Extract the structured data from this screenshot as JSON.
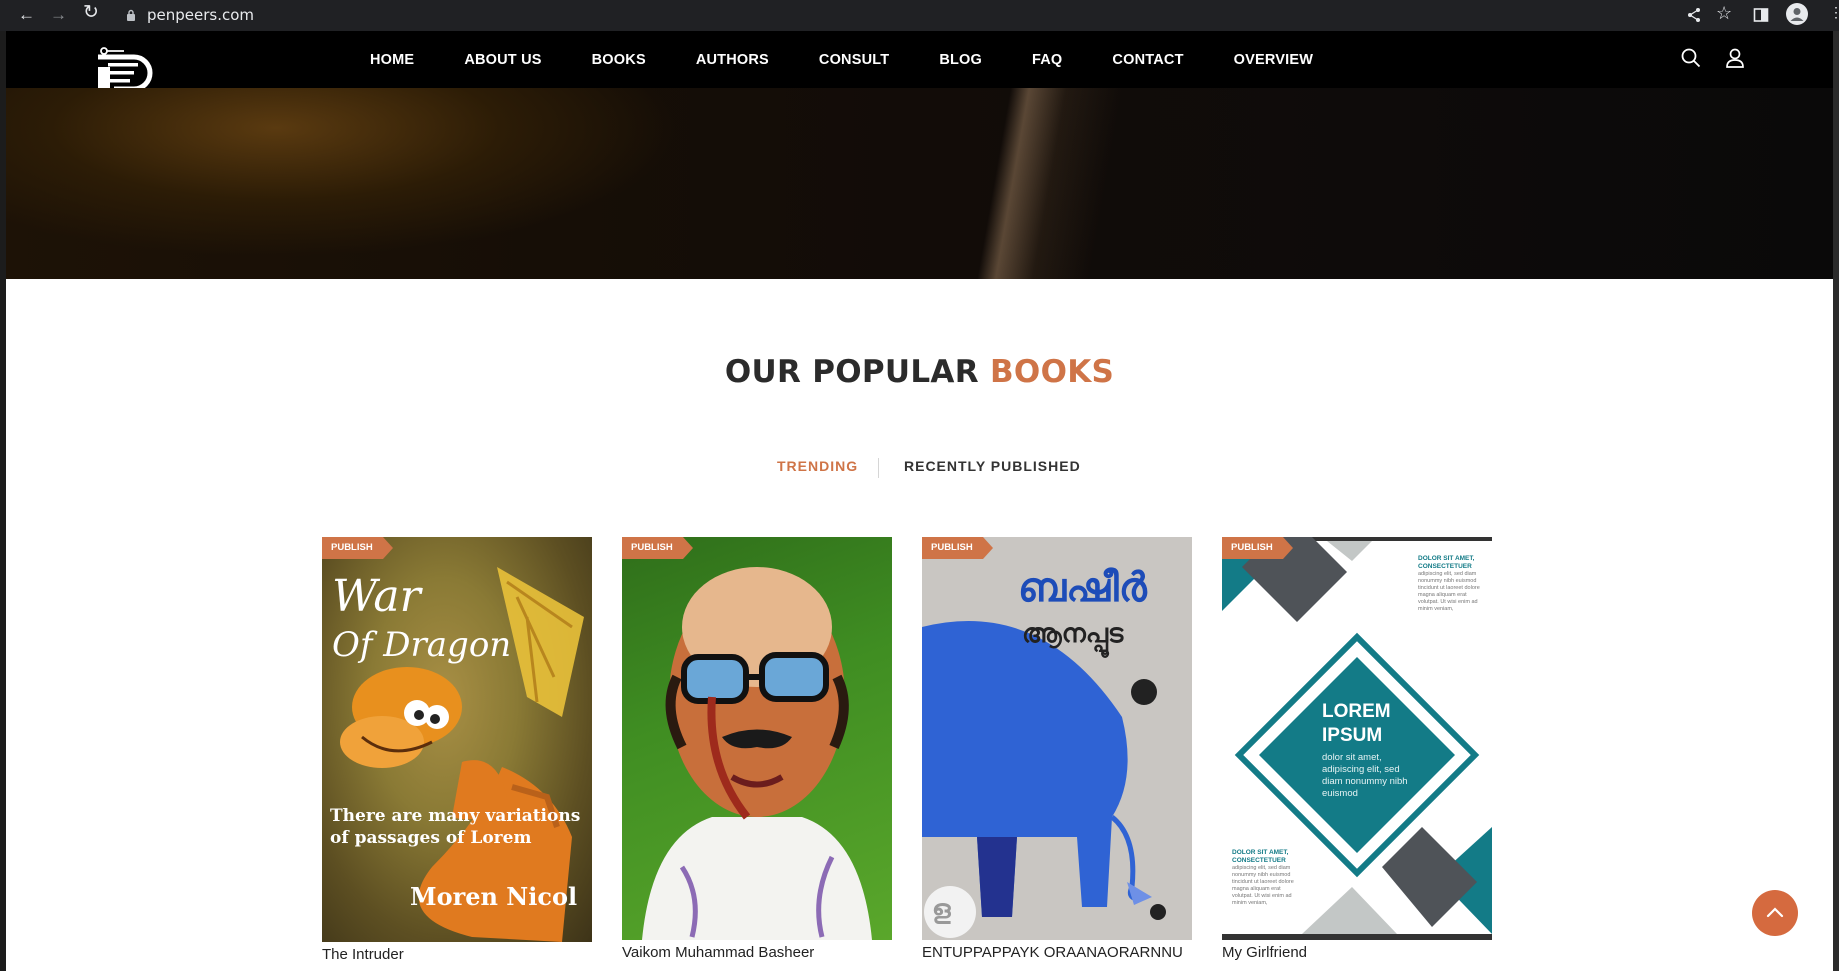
{
  "browser": {
    "url": "penpeers.com"
  },
  "nav": {
    "items": [
      "HOME",
      "ABOUT US",
      "BOOKS",
      "AUTHORS",
      "CONSULT",
      "BLOG",
      "FAQ",
      "CONTACT",
      "OVERVIEW"
    ]
  },
  "section": {
    "title_part1": "OUR POPULAR",
    "title_part2": "BOOKS",
    "tabs": [
      {
        "label": "TRENDING",
        "active": true
      },
      {
        "label": "RECENTLY PUBLISHED",
        "active": false
      }
    ]
  },
  "books": [
    {
      "badge": "PUBLISH",
      "title": "The Intruder",
      "cover_title_line1": "War",
      "cover_title_line2": "Of Dragon",
      "cover_text": "There are many variations of passages of Lorem",
      "cover_author": "Moren Nicol"
    },
    {
      "badge": "PUBLISH",
      "title": "Vaikom Muhammad Basheer"
    },
    {
      "badge": "PUBLISH",
      "title": "ENTUPPAPPAYK ORAANAORARNNU",
      "cover_title_line1": "ബഷീർ",
      "cover_title_line2": "ആനപ്പൂട",
      "cover_mark": "ള"
    },
    {
      "badge": "PUBLISH",
      "title": "My Girlfriend",
      "cover_heading_line1": "LOREM",
      "cover_heading_line2": "IPSUM",
      "cover_body": "dolor sit amet, adipiscing elit, sed diam nonummy nibh euismod",
      "cover_corner_title": "DOLOR SIT AMET, CONSECTETUER",
      "cover_corner_body": "adipiscing elit, sed diam nonummy nibh euismod tincidunt ut laoreet dolore magna aliquam erat volutpat. Ut wisi enim ad minim veniam,"
    }
  ],
  "colors": {
    "accent": "#cf7447",
    "header_bg": "#000000",
    "heading": "#2b2b2b",
    "teal": "#137b87"
  }
}
